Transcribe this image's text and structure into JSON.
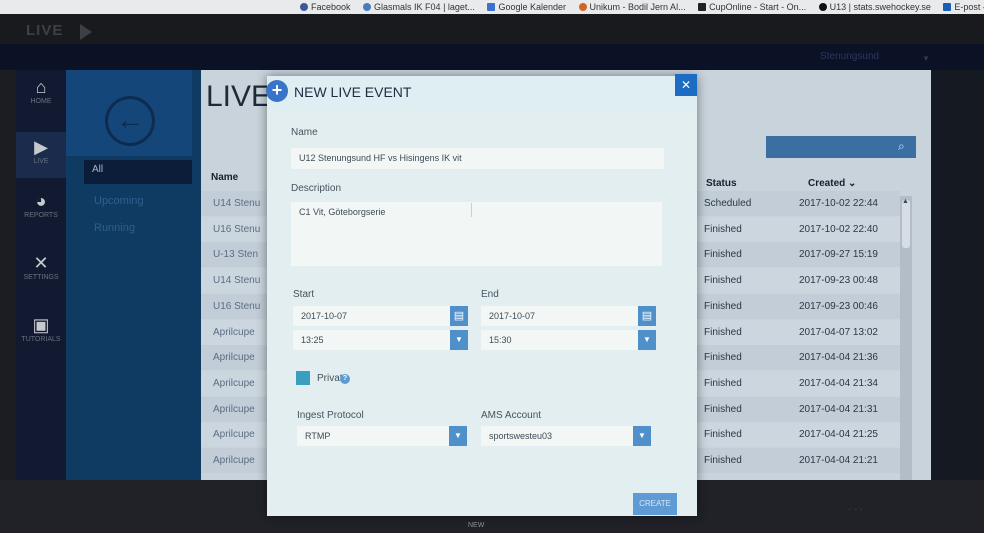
{
  "browser": {
    "bookmarks": [
      "Facebook",
      "Glasmals IK F04 | laget...",
      "Google Kalender",
      "Unikum - Bodil Jern Al...",
      "CupOnline - Start - On...",
      "U13 | stats.swehockey.se",
      "E-post – Bodil Je"
    ]
  },
  "app": {
    "brand": "LIVE",
    "org_select": "Stenungsund"
  },
  "rail": [
    {
      "label": "HOME",
      "icon": "home-icon"
    },
    {
      "label": "LIVE",
      "icon": "live-camera-icon"
    },
    {
      "label": "REPORTS",
      "icon": "reports-icon"
    },
    {
      "label": "SETTINGS",
      "icon": "settings-tools-icon"
    },
    {
      "label": "TUTORIALS",
      "icon": "tutorials-icon"
    }
  ],
  "nav2": {
    "all": "All",
    "items": [
      "Upcoming",
      "Running"
    ]
  },
  "main": {
    "title": "LIVE",
    "columns": {
      "name": "Name",
      "status": "Status",
      "created": "Created ⌄"
    },
    "rows": [
      {
        "name": "U14 Stenu",
        "status": "Scheduled",
        "created": "2017-10-02 22:44"
      },
      {
        "name": "U16 Stenu",
        "status": "Finished",
        "created": "2017-10-02 22:40"
      },
      {
        "name": "U-13 Sten",
        "status": "Finished",
        "created": "2017-09-27 15:19"
      },
      {
        "name": "U14 Stenu",
        "status": "Finished",
        "created": "2017-09-23 00:48"
      },
      {
        "name": "U16 Stenu",
        "status": "Finished",
        "created": "2017-09-23 00:46"
      },
      {
        "name": "Aprilcupe",
        "status": "Finished",
        "created": "2017-04-07 13:02"
      },
      {
        "name": "Aprilcupe",
        "status": "Finished",
        "created": "2017-04-04 21:36"
      },
      {
        "name": "Aprilcupe",
        "status": "Finished",
        "created": "2017-04-04 21:34"
      },
      {
        "name": "Aprilcupe",
        "status": "Finished",
        "created": "2017-04-04 21:31"
      },
      {
        "name": "Aprilcupe",
        "status": "Finished",
        "created": "2017-04-04 21:25"
      },
      {
        "name": "Aprilcupe",
        "status": "Finished",
        "created": "2017-04-04 21:21"
      }
    ]
  },
  "modal": {
    "title": "NEW LIVE EVENT",
    "name_label": "Name",
    "name_value": "U12 Stenungsund HF vs Hisingens IK vit",
    "description_label": "Description",
    "description_value": "C1 Vit, Göteborgserie",
    "start_label": "Start",
    "start_date": "2017-10-07",
    "start_time": "13:25",
    "end_label": "End",
    "end_date": "2017-10-07",
    "end_time": "15:30",
    "private_label": "Private",
    "ingest_label": "Ingest Protocol",
    "ingest_value": "RTMP",
    "ams_label": "AMS Account",
    "ams_value": "sportswesteu03",
    "create_label": "CREATE"
  },
  "footer": {
    "new_label": "NEW"
  }
}
